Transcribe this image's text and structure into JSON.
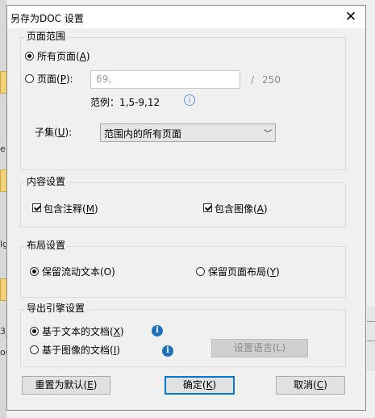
{
  "background": {
    "left_texts": [
      "e",
      "lg",
      "3_",
      "oc"
    ]
  },
  "dialog": {
    "title": "另存为DOC 设置",
    "close_glyph": "✕"
  },
  "page_range": {
    "label": "页面范围",
    "all_pages": {
      "text": "所有页面(",
      "key": "A",
      "end": ")",
      "selected": true
    },
    "pages": {
      "text": "页面(",
      "key": "P",
      "end": "):",
      "selected": false
    },
    "pages_value": "69,",
    "separator": "/",
    "total_pages": "250",
    "example": "范例：1,5-9,12",
    "subset": {
      "text": "子集(",
      "key": "U",
      "end": "):"
    },
    "subset_value": "范围内的所有页面"
  },
  "content": {
    "label": "内容设置",
    "include_comments": {
      "text": "包含注释(",
      "key": "M",
      "end": ")",
      "checked": true
    },
    "include_images": {
      "text": "包含图像(",
      "key": "A",
      "end": ")",
      "checked": true
    }
  },
  "layout": {
    "label": "布局设置",
    "flow_text": {
      "text": "保留流动文本(O)",
      "selected": true
    },
    "page_layout": {
      "text": "保留页面布局(",
      "key": "Y",
      "end": ")",
      "selected": false
    }
  },
  "engine": {
    "label": "导出引擎设置",
    "text_doc": {
      "text": "基于文本的文档(",
      "key": "X",
      "end": ")",
      "selected": true
    },
    "image_doc": {
      "text": "基于图像的文档(",
      "key": "I",
      "end": ")",
      "selected": false
    },
    "lang_button": "设置语言(L)"
  },
  "buttons": {
    "reset": {
      "text": "重置为默认(",
      "key": "E",
      "end": ")"
    },
    "ok": {
      "text": "确定(",
      "key": "K",
      "end": ")"
    },
    "cancel": {
      "text": "取消(",
      "key": "C",
      "end": ")"
    }
  },
  "colors": {
    "info_blue": "#1f6fbf",
    "focus_blue": "#0078d7"
  }
}
